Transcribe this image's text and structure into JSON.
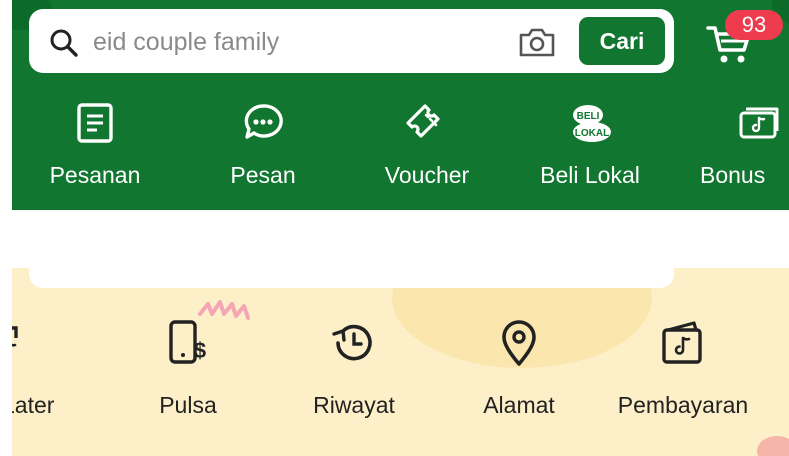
{
  "search": {
    "placeholder": "eid couple family",
    "button_label": "Cari",
    "cart_badge": "93"
  },
  "top_nav": [
    {
      "label": "Pesanan",
      "icon": "order-list-icon"
    },
    {
      "label": "Pesan",
      "icon": "chat-bubble-icon"
    },
    {
      "label": "Voucher",
      "icon": "voucher-ticket-icon"
    },
    {
      "label": "Beli Lokal",
      "icon": "beli-lokal-icon",
      "icon_text": [
        "BELI",
        "LOKAL"
      ]
    },
    {
      "label": "Bonus",
      "icon": "bonus-money-icon"
    }
  ],
  "utilities": [
    {
      "label": "Later",
      "icon": "paylater-icon"
    },
    {
      "label": "Pulsa",
      "icon": "pulsa-phone-icon"
    },
    {
      "label": "Riwayat",
      "icon": "history-icon"
    },
    {
      "label": "Alamat",
      "icon": "location-pin-icon"
    },
    {
      "label": "Pembayaran",
      "icon": "wallet-icon"
    }
  ],
  "colors": {
    "brand_green": "#11762f",
    "badge_red": "#ef3b4e",
    "utility_background": "#fdf0c9"
  }
}
